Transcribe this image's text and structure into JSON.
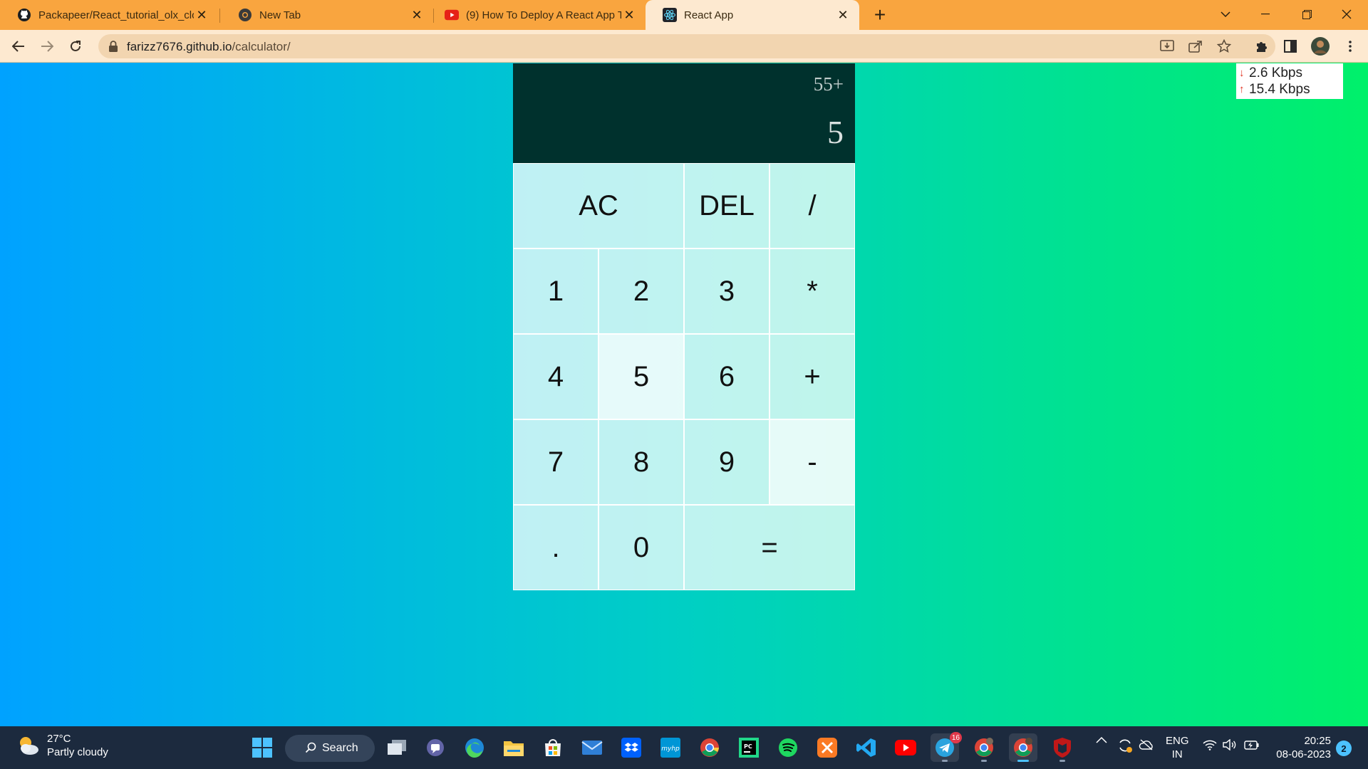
{
  "browser": {
    "tabs": [
      {
        "title": "Packapeer/React_tutorial_olx_clo",
        "icon": "github-icon"
      },
      {
        "title": "New Tab",
        "icon": "chrome-icon"
      },
      {
        "title": "(9) How To Deploy A React App T",
        "icon": "youtube-icon"
      },
      {
        "title": "React App",
        "icon": "react-icon",
        "active": true
      }
    ],
    "new_tab_label": "+",
    "address": {
      "host": "farizz7676.github.io",
      "path": "/calculator/"
    }
  },
  "calculator": {
    "previous_operand": "55+",
    "current_operand": "5",
    "keys": [
      "AC",
      "DEL",
      "/",
      "1",
      "2",
      "3",
      "*",
      "4",
      "5",
      "6",
      "+",
      "7",
      "8",
      "9",
      "-",
      ".",
      "0",
      "="
    ]
  },
  "speed_widget": {
    "download": "2.6 Kbps",
    "upload": "15.4 Kbps"
  },
  "taskbar": {
    "weather": {
      "temp": "27°C",
      "condition": "Partly cloudy"
    },
    "search_label": "Search",
    "telegram_badge": "16",
    "language": {
      "line1": "ENG",
      "line2": "IN"
    },
    "time": "20:25",
    "date": "08-06-2023",
    "notification_count": "2"
  },
  "colors": {
    "tab_strip": "#f9a53f",
    "toolbar": "#fde9d0",
    "display_bg": "#00312d",
    "gradient_left": "#00a2ff",
    "gradient_right": "#00f06a",
    "taskbar": "#1c2a3e"
  }
}
